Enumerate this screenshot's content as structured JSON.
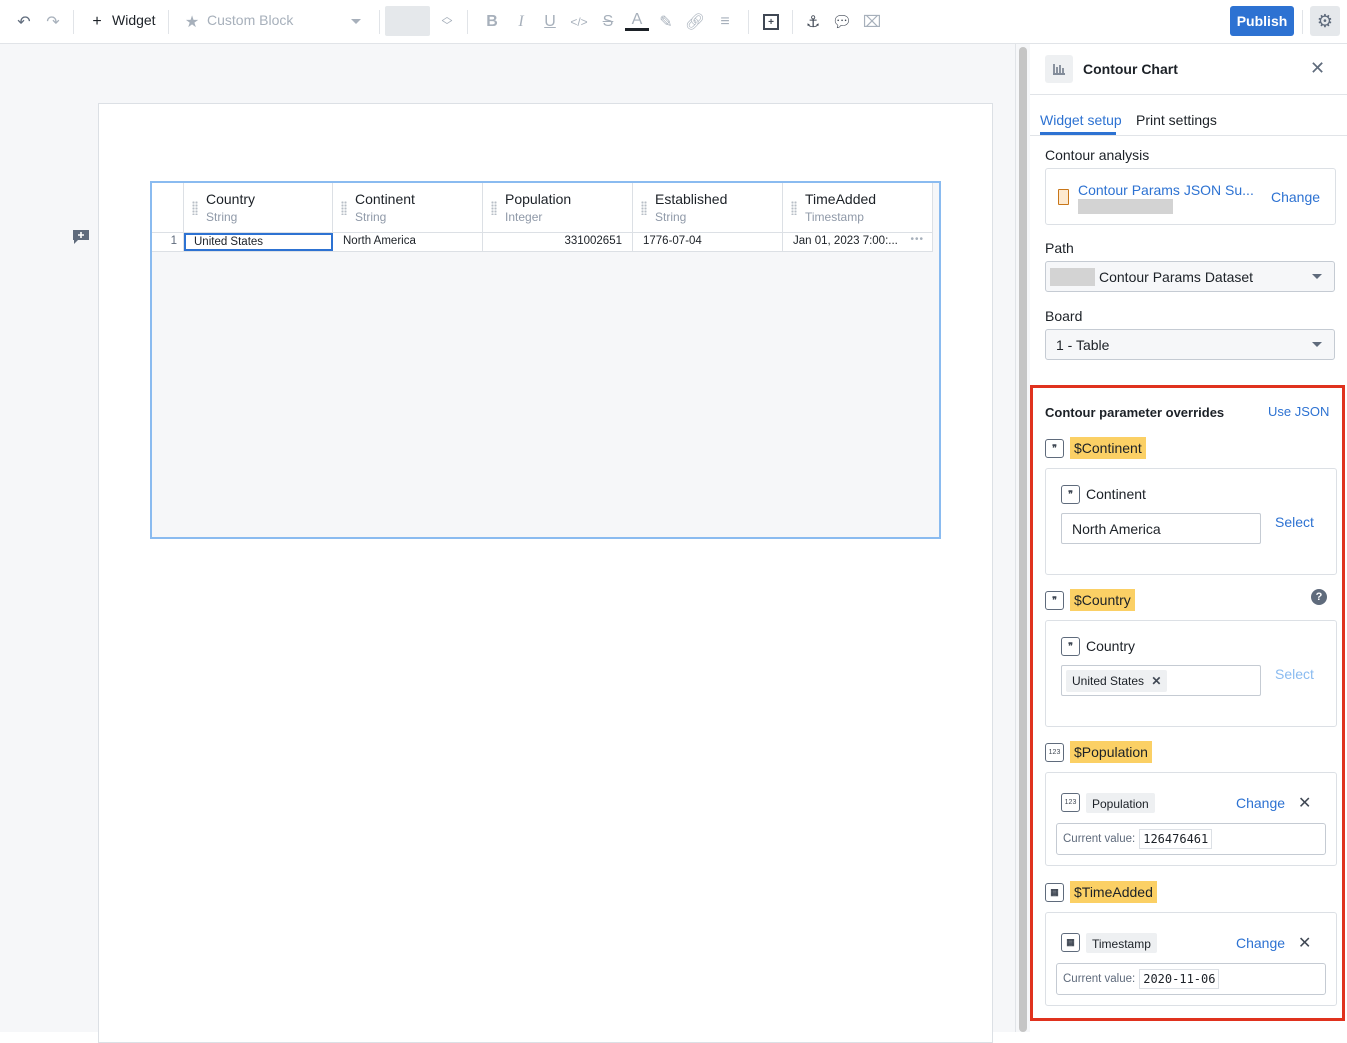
{
  "toolbar": {
    "widget_label": "Widget",
    "block_select": "Custom Block",
    "publish_label": "Publish"
  },
  "table": {
    "columns": [
      {
        "name": "Country",
        "type": "String"
      },
      {
        "name": "Continent",
        "type": "String"
      },
      {
        "name": "Population",
        "type": "Integer"
      },
      {
        "name": "Established",
        "type": "String"
      },
      {
        "name": "TimeAdded",
        "type": "Timestamp"
      }
    ],
    "rows": [
      {
        "index": "1",
        "cells": [
          "United States",
          "North America",
          "331002651",
          "1776-07-04",
          "Jan 01, 2023 7:00:..."
        ]
      }
    ],
    "row_menu": "•••"
  },
  "panel": {
    "title": "Contour Chart",
    "tabs": [
      "Widget setup",
      "Print settings"
    ],
    "analysis_label": "Contour analysis",
    "analysis_name": "Contour Params JSON Su...",
    "change_label": "Change",
    "path_label": "Path",
    "path_value": "Contour Params Dataset",
    "board_label": "Board",
    "board_value": "1 - Table",
    "overrides": {
      "title": "Contour parameter overrides",
      "use_json": "Use JSON",
      "params": [
        {
          "tag": "$Continent",
          "field": "Continent",
          "value": "North America",
          "action": "Select"
        },
        {
          "tag": "$Country",
          "field": "Country",
          "chip": "United States",
          "action": "Select"
        },
        {
          "tag": "$Population",
          "field": "Population",
          "current_label": "Current value:",
          "current_value": "126476461",
          "action": "Change"
        },
        {
          "tag": "$TimeAdded",
          "field": "Timestamp",
          "current_label": "Current value:",
          "current_value": "2020-11-06",
          "action": "Change"
        }
      ]
    }
  }
}
